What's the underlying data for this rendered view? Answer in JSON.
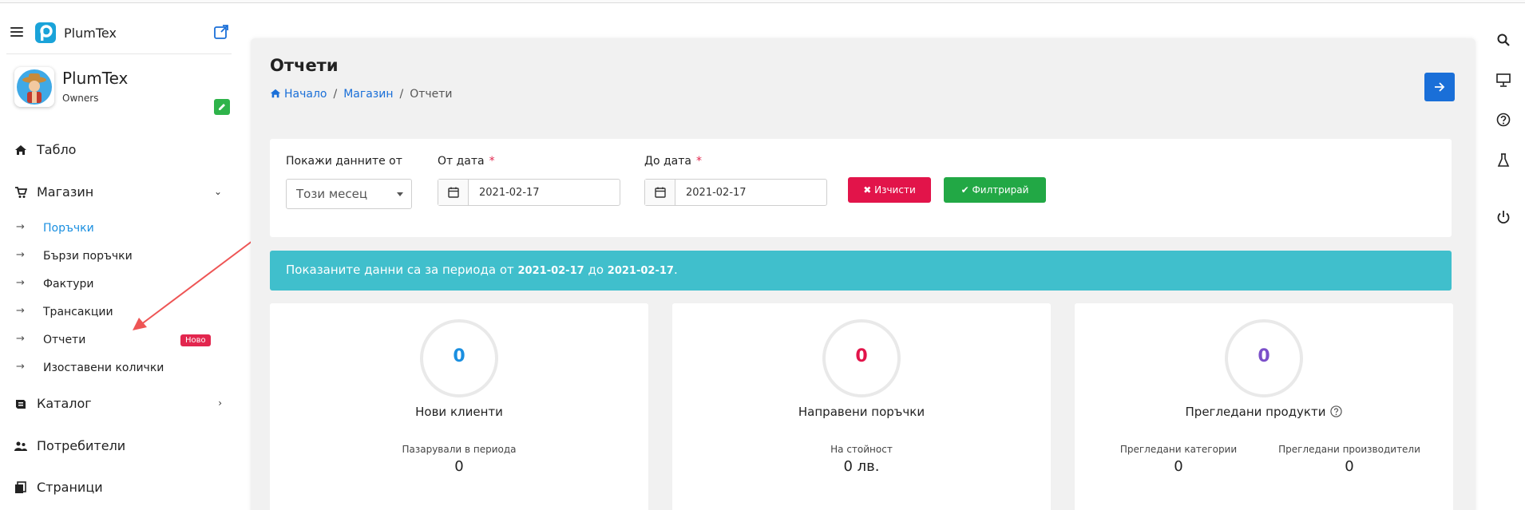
{
  "app": {
    "brand": "PlumTex"
  },
  "profile": {
    "name": "PlumTex",
    "role": "Owners"
  },
  "nav": {
    "dashboard": "Табло",
    "shop": "Магазин",
    "shop_items": [
      {
        "label": "Поръчки",
        "active": true
      },
      {
        "label": "Бързи поръчки"
      },
      {
        "label": "Фактури"
      },
      {
        "label": "Трансакции"
      },
      {
        "label": "Отчети",
        "badge": "Ново"
      },
      {
        "label": "Изоставени колички"
      }
    ],
    "catalog": "Каталог",
    "users": "Потребители",
    "pages": "Страници",
    "sub_arrow": "→"
  },
  "page": {
    "title": "Отчети",
    "breadcrumb": {
      "home": "Начало",
      "shop": "Магазин",
      "current": "Отчети",
      "separator": "/"
    }
  },
  "filters": {
    "period_label": "Покажи данните от",
    "period_value": "Този месец",
    "from_label": "От дата",
    "from_value": "2021-02-17",
    "to_label": "До дата",
    "to_value": "2021-02-17",
    "required_mark": "*",
    "clear_label": "✖ Изчисти",
    "filter_label": "✔ Филтрирай"
  },
  "info": {
    "prefix": "Показаните данни са за периода от",
    "from": "2021-02-17",
    "middle": "до",
    "to": "2021-02-17",
    "suffix": "."
  },
  "stats": {
    "new_clients": {
      "value": "0",
      "title": "Нови клиенти",
      "sub_label": "Пазарували в периода",
      "sub_value": "0"
    },
    "orders": {
      "value": "0",
      "title": "Направени поръчки",
      "sub_label": "На стойност",
      "sub_value": "0 лв."
    },
    "viewed": {
      "value": "0",
      "title": "Прегледани продукти",
      "sub1_label": "Прегледани категории",
      "sub1_value": "0",
      "sub2_label": "Прегледани производители",
      "sub2_value": "0"
    }
  },
  "colors": {
    "accent_blue": "#1a6fd8",
    "info_teal": "#40bfcc",
    "danger": "#e2144a",
    "success": "#22a845",
    "stat_blue": "#1a8fe0",
    "stat_red": "#e2144a",
    "stat_purple": "#7b4fc9"
  },
  "icons": [
    "hamburger-icon",
    "external-link-icon",
    "edit-icon",
    "home-icon",
    "cart-icon",
    "catalog-icon",
    "users-icon",
    "pages-icon",
    "calendar-icon",
    "arrow-right-icon",
    "search-icon",
    "presentation-icon",
    "help-icon",
    "flask-icon",
    "power-icon"
  ]
}
